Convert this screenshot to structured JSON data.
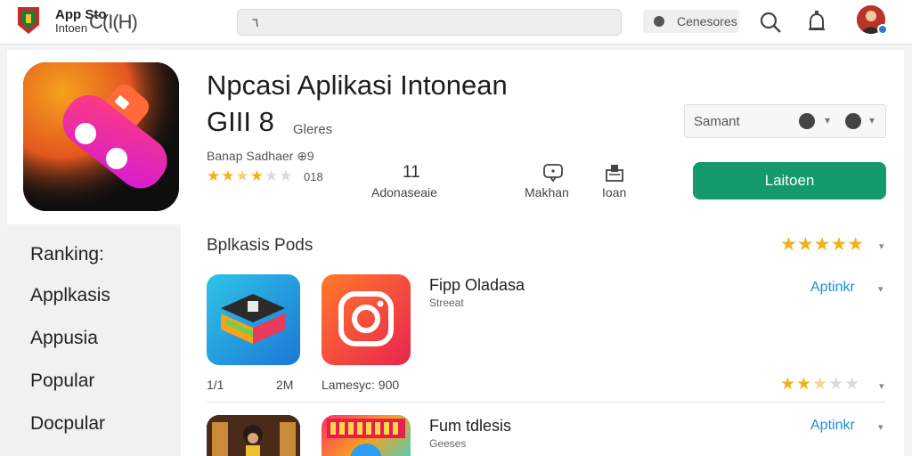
{
  "topbar": {
    "brand_line1": "App Sto",
    "brand_line2": "Intoen",
    "brand_watermark": "C(I(H)",
    "search_value": "٦",
    "categories_label": "Cenesores",
    "icons": [
      "logo-icon",
      "search-icon",
      "bell-icon",
      "avatar"
    ]
  },
  "sidebar": {
    "heading": "Ranking:",
    "items": [
      {
        "label": "Applkasis"
      },
      {
        "label": "Appusia"
      },
      {
        "label": "Popular"
      },
      {
        "label": "Docpular"
      }
    ]
  },
  "app": {
    "title": "Npcasi Aplikasi Intonean",
    "version": "GIII 8",
    "version_sub": "Gleres",
    "developer": "Banap Sadhaer ⊕9",
    "rating_stars": 2.5,
    "rating_count": "018",
    "stat_number": "11",
    "stat_number_label": "Adonaseaie",
    "stat_makhan_label": "Makhan",
    "stat_ioan_label": "Ioan",
    "install_label": "Laitoen",
    "sort_label": "Samant"
  },
  "section": {
    "title": "Bplkasis Pods",
    "rating_stars": 5
  },
  "rows": [
    {
      "title": "Fipp Oladasa",
      "subtitle": "Streeat",
      "link": "Aptinkr",
      "meta_left": "1/1",
      "meta_size": "2M",
      "meta_info": "Lamesyc: 900",
      "rating_stars": 2.5
    },
    {
      "title": "Fum tdlesis",
      "subtitle": "Geeses",
      "link": "Aptinkr"
    }
  ],
  "colors": {
    "accent_green": "#159a6e",
    "link_blue": "#1b8fd0",
    "star_gold": "#f2b01e"
  }
}
